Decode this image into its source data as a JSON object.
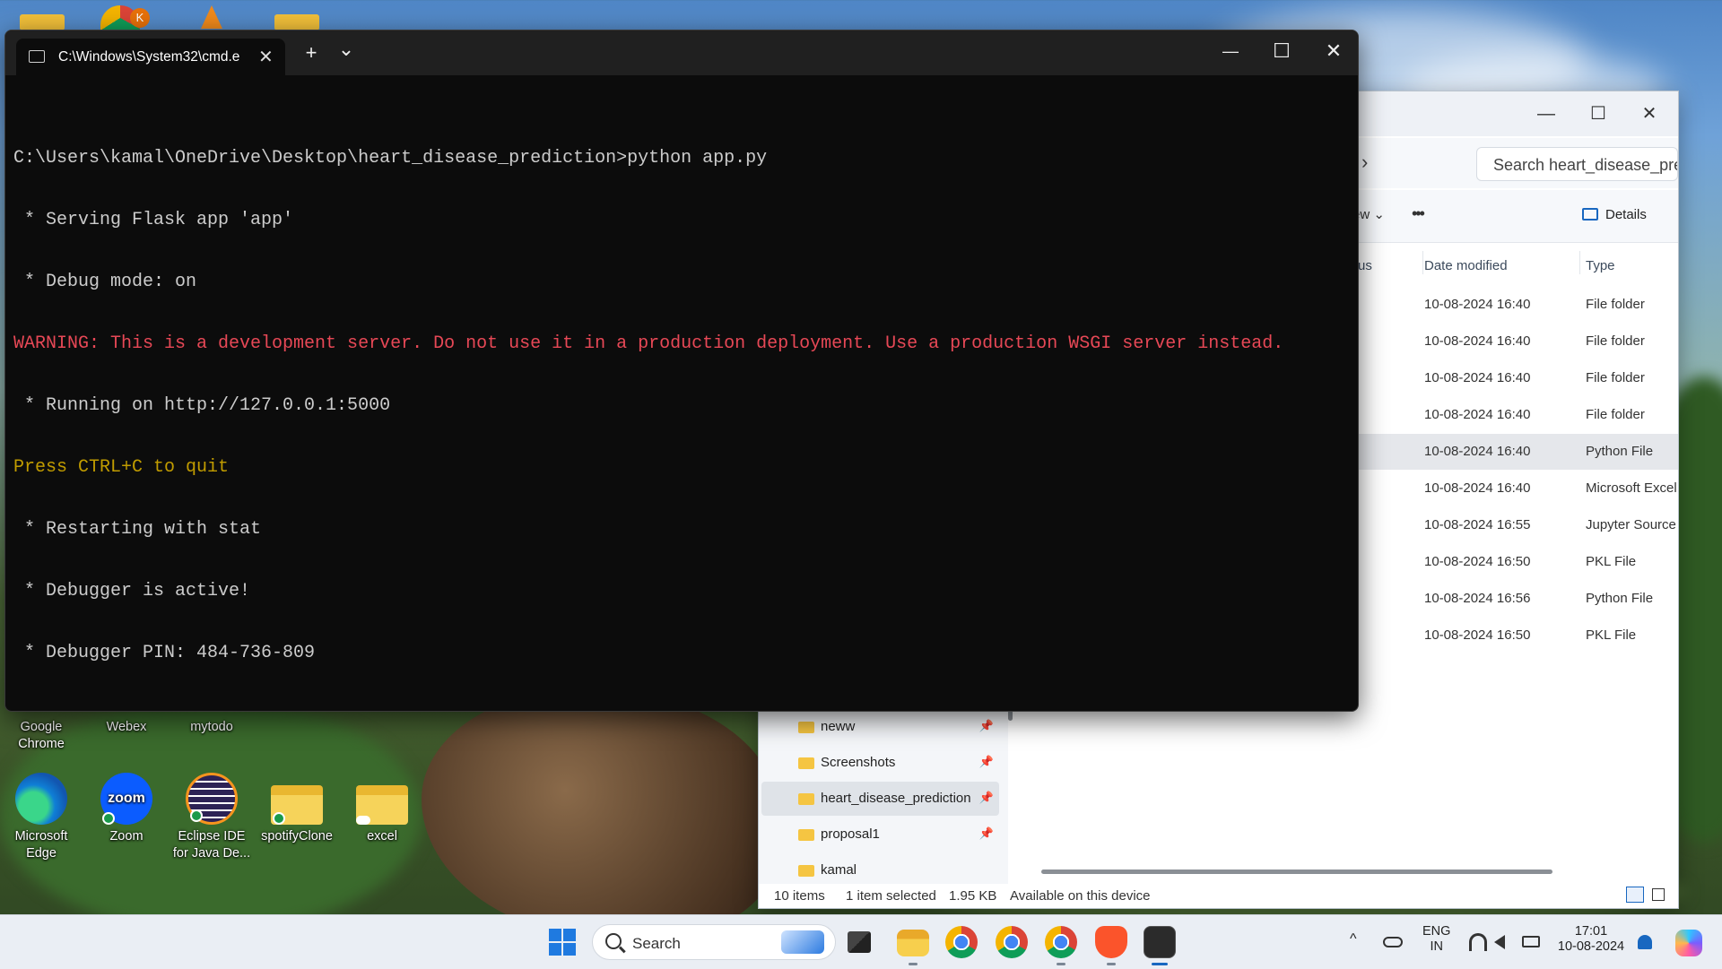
{
  "desktop": {
    "partial_row_top": [
      "Google Chrome",
      "Webex",
      "mytodo"
    ],
    "icons": [
      {
        "label": "Microsoft Edge",
        "icon": "edge-icon"
      },
      {
        "label": "Zoom",
        "icon": "zoom-icon",
        "inner": "zoom"
      },
      {
        "label": "Eclipse IDE for Java De...",
        "icon": "eclipse-icon"
      },
      {
        "label": "spotifyClone",
        "icon": "folder-icon"
      },
      {
        "label": "excel",
        "icon": "folder-icon"
      }
    ]
  },
  "terminal": {
    "tab_title": "C:\\Windows\\System32\\cmd.e",
    "new_tab": "+",
    "dropdown": "⌄",
    "minimize": "—",
    "maximize": "☐",
    "close": "✕",
    "lines": [
      {
        "text": "",
        "color": "default"
      },
      {
        "text": "C:\\Users\\kamal\\OneDrive\\Desktop\\heart_disease_prediction>python app.py",
        "color": "default"
      },
      {
        "text": " * Serving Flask app 'app'",
        "color": "default"
      },
      {
        "text": " * Debug mode: on",
        "color": "default"
      },
      {
        "text": "WARNING: This is a development server. Do not use it in a production deployment. Use a production WSGI server instead.",
        "color": "red"
      },
      {
        "text": " * Running on http://127.0.0.1:5000",
        "color": "default"
      },
      {
        "text": "Press CTRL+C to quit",
        "color": "yellow"
      },
      {
        "text": " * Restarting with stat",
        "color": "default"
      },
      {
        "text": " * Debugger is active!",
        "color": "default"
      },
      {
        "text": " * Debugger PIN: 484-736-809",
        "color": "default"
      }
    ]
  },
  "explorer": {
    "minimize": "—",
    "maximize": "☐",
    "close": "✕",
    "breadcrumb_chevron": "›",
    "search_placeholder": "Search heart_disease_predi",
    "toolbar": {
      "view_label_partial": "ew ⌄",
      "more": "•••",
      "details_label": "Details"
    },
    "columns": {
      "status_partial": "us",
      "date_modified": "Date modified",
      "type": "Type"
    },
    "rows": [
      {
        "date": "10-08-2024 16:40",
        "type": "File folder",
        "selected": false
      },
      {
        "date": "10-08-2024 16:40",
        "type": "File folder",
        "selected": false
      },
      {
        "date": "10-08-2024 16:40",
        "type": "File folder",
        "selected": false
      },
      {
        "date": "10-08-2024 16:40",
        "type": "File folder",
        "selected": false
      },
      {
        "date": "10-08-2024 16:40",
        "type": "Python File",
        "selected": true
      },
      {
        "date": "10-08-2024 16:40",
        "type": "Microsoft Excel",
        "selected": false
      },
      {
        "date": "10-08-2024 16:55",
        "type": "Jupyter Source",
        "selected": false
      },
      {
        "date": "10-08-2024 16:50",
        "type": "PKL File",
        "selected": false
      },
      {
        "date": "10-08-2024 16:56",
        "type": "Python File",
        "selected": false
      },
      {
        "date": "10-08-2024 16:50",
        "type": "PKL File",
        "selected": false
      }
    ],
    "nav_items": [
      {
        "label": "neww",
        "selected": false
      },
      {
        "label": "Screenshots",
        "selected": false
      },
      {
        "label": "heart_disease_prediction",
        "selected": true
      },
      {
        "label": "proposal1",
        "selected": false
      },
      {
        "label": "kamal",
        "selected": false
      }
    ],
    "status": {
      "items": "10 items",
      "selected": "1 item selected",
      "size": "1.95 KB",
      "availability": "Available on this device"
    }
  },
  "taskbar": {
    "search_label": "Search",
    "tray": {
      "language": "ENG",
      "region": "IN",
      "time": "17:01",
      "date": "10-08-2024",
      "chevron": "^"
    },
    "colors": {
      "accent": "#1867c0",
      "terminal_red": "#e74856",
      "terminal_yellow": "#c19c00"
    }
  }
}
